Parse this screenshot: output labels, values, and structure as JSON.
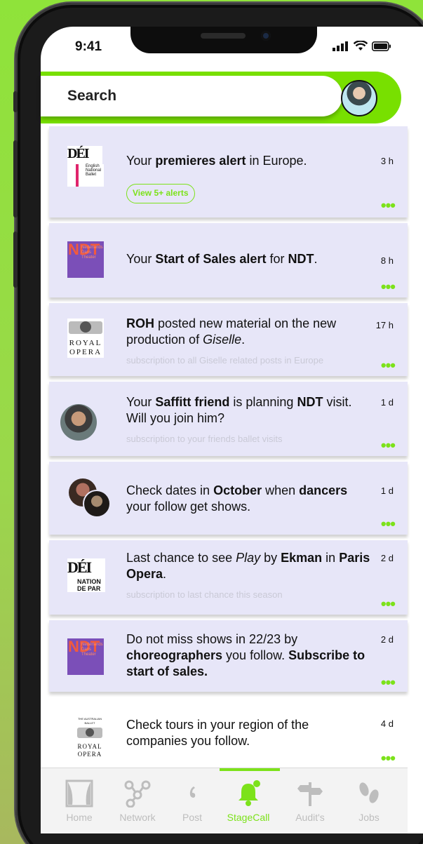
{
  "status": {
    "time": "9:41"
  },
  "search": {
    "label": "Search"
  },
  "feed": [
    {
      "logo_text": [
        "DÉI",
        "English",
        "National",
        "Ballet"
      ],
      "text_html": "Your <b>premieres alert</b> in Europe.",
      "time": "3 h",
      "button": "View 5+ alerts"
    },
    {
      "logo_text": [
        "NDT",
        "Nederlands Dans Theater"
      ],
      "text_html": "Your <b>Start of Sales alert</b> for <b>NDT</b>.",
      "time": "8 h"
    },
    {
      "logo_text": [
        "ROYAL",
        "OPERA"
      ],
      "text_html": "<b>ROH</b> posted new material on the new production of <i>Giselle</i>.",
      "time": "17 h",
      "sub": "subscription to all Giselle related posts in Europe"
    },
    {
      "text_html": "Your <b>Saffitt friend</b> is planning <b>NDT</b> visit. Will you join him?",
      "time": "1 d",
      "sub": "subscription to your friends ballet visits"
    },
    {
      "text_html": "Check dates in <b>October</b> when <b>dancers</b> your follow get shows.",
      "time": "1 d"
    },
    {
      "logo_text": [
        "DÉI",
        "NATION",
        "DE PAR"
      ],
      "text_html": "Last chance to see <i>Play</i> by <b>Ekman</b> in <b>Paris Opera</b>.",
      "time": "2 d",
      "sub": "subscription to last chance this season"
    },
    {
      "logo_text": [
        "NDT",
        "Nederlands Dans Theater"
      ],
      "text_html": "Do not miss shows in 22/23 by <b>choreographers</b> you follow. <b>Subscribe to start of sales.</b>",
      "time": "2 d"
    },
    {
      "logo_text": [
        "THE AUSTRALIAN BALLET",
        "ROYAL",
        "OPERA"
      ],
      "text_html": "Check tours in your region of the companies you follow.",
      "time": "4 d"
    }
  ],
  "dots": "•••",
  "nav": [
    {
      "label": "Home",
      "icon": "theater-curtain-icon"
    },
    {
      "label": "Network",
      "icon": "network-icon"
    },
    {
      "label": "Post",
      "icon": "quote-icon"
    },
    {
      "label": "StageCall",
      "icon": "bell-icon",
      "active": true
    },
    {
      "label": "Audit's",
      "icon": "signpost-icon"
    },
    {
      "label": "Jobs",
      "icon": "footsteps-icon"
    }
  ],
  "colors": {
    "accent": "#7ce21a",
    "card": "#e7e6f8",
    "ndt_purple": "#7b4fb8",
    "ndt_orange": "#f25a3c"
  }
}
